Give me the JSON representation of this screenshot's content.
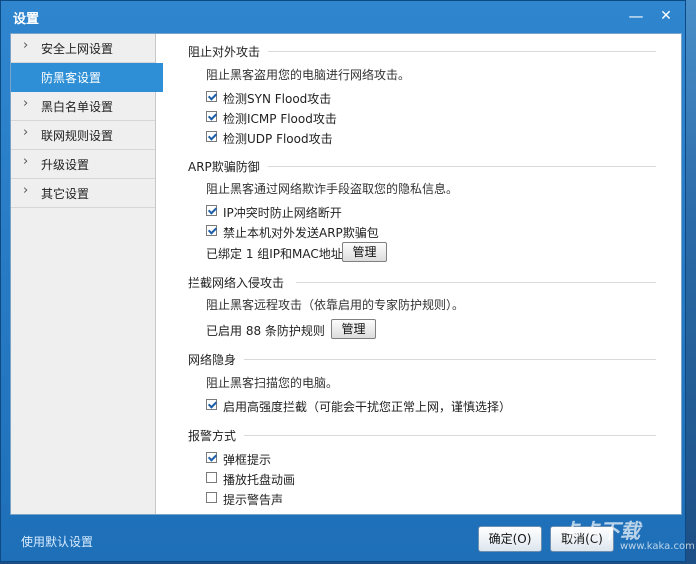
{
  "window": {
    "title": "设置",
    "minimize_icon": "minimize-icon",
    "close_icon": "close-icon"
  },
  "sidebar": {
    "items": [
      {
        "label": "安全上网设置",
        "active": false
      },
      {
        "label": "防黑客设置",
        "active": true
      },
      {
        "label": "黑白名单设置",
        "active": false
      },
      {
        "label": "联网规则设置",
        "active": false
      },
      {
        "label": "升级设置",
        "active": false
      },
      {
        "label": "其它设置",
        "active": false
      }
    ]
  },
  "sections": {
    "attack": {
      "title": "阻止对外攻击",
      "desc": "阻止黑客盗用您的电脑进行网络攻击。",
      "options": [
        {
          "label": "检测SYN Flood攻击",
          "checked": true
        },
        {
          "label": "检测ICMP Flood攻击",
          "checked": true
        },
        {
          "label": "检测UDP Flood攻击",
          "checked": true
        }
      ]
    },
    "arp": {
      "title": "ARP欺骗防御",
      "desc": "阻止黑客通过网络欺诈手段盗取您的隐私信息。",
      "options": [
        {
          "label": "IP冲突时防止网络断开",
          "checked": true
        },
        {
          "label": "禁止本机对外发送ARP欺骗包",
          "checked": true
        }
      ],
      "bound_text": "已绑定 1 组IP和MAC地址",
      "manage_label": "管理"
    },
    "intrusion": {
      "title": "拦截网络入侵攻击",
      "desc": "阻止黑客远程攻击（依靠启用的专家防护规则）。",
      "rules_text": "已启用 88 条防护规则",
      "manage_label": "管理"
    },
    "stealth": {
      "title": "网络隐身",
      "desc": "阻止黑客扫描您的电脑。",
      "options": [
        {
          "label": "启用高强度拦截（可能会干扰您正常上网，谨慎选择）",
          "checked": true
        }
      ]
    },
    "alert": {
      "title": "报警方式",
      "options": [
        {
          "label": "弹框提示",
          "checked": true
        },
        {
          "label": "播放托盘动画",
          "checked": false
        },
        {
          "label": "提示警告声",
          "checked": false
        }
      ]
    }
  },
  "footer": {
    "default_link": "使用默认设置",
    "ok_label": "确定(O)",
    "cancel_label": "取消(C)",
    "watermark": "卡卡下载",
    "watermark_url": "www.kaka.com"
  },
  "colors": {
    "titlebar": "#1e6fb8",
    "active_nav": "#2e8fd6",
    "checkmark": "#1d5fa8"
  }
}
